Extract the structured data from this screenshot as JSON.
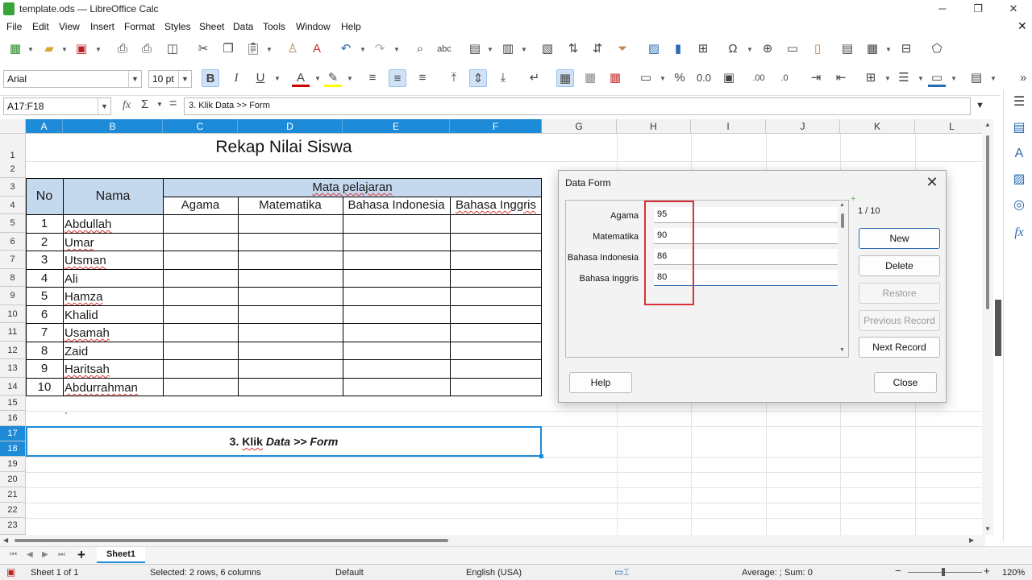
{
  "window": {
    "title": "template.ods — LibreOffice Calc"
  },
  "menubar": [
    "File",
    "Edit",
    "View",
    "Insert",
    "Format",
    "Styles",
    "Sheet",
    "Data",
    "Tools",
    "Window",
    "Help"
  ],
  "format_toolbar": {
    "font_name": "Arial",
    "font_size": "10 pt"
  },
  "formula_bar": {
    "name_box": "A17:F18",
    "fx": "fx",
    "sigma": "Σ",
    "equals": "=",
    "content": "3. Klik Data >> Form"
  },
  "columns": [
    "A",
    "B",
    "C",
    "D",
    "E",
    "F",
    "G",
    "H",
    "I",
    "J",
    "K",
    "L"
  ],
  "rows": [
    "1",
    "2",
    "3",
    "4",
    "5",
    "6",
    "7",
    "8",
    "9",
    "10",
    "11",
    "12",
    "13",
    "14",
    "15",
    "16",
    "17",
    "18",
    "19",
    "20",
    "21",
    "22",
    "23"
  ],
  "sheet": {
    "title": "Rekap Nilai Siswa",
    "header_no": "No",
    "header_nama": "Nama",
    "header_mapel": "Mata pelajaran",
    "subjects": [
      "Agama",
      "Matematika",
      "Bahasa Indonesia",
      "Bahasa Inggris"
    ],
    "students": [
      {
        "no": "1",
        "nama": "Abdullah"
      },
      {
        "no": "2",
        "nama": "Umar"
      },
      {
        "no": "3",
        "nama": "Utsman"
      },
      {
        "no": "4",
        "nama": "Ali"
      },
      {
        "no": "5",
        "nama": "Hamza"
      },
      {
        "no": "6",
        "nama": "Khalid"
      },
      {
        "no": "7",
        "nama": "Usamah"
      },
      {
        "no": "8",
        "nama": "Zaid"
      },
      {
        "no": "9",
        "nama": "Haritsah"
      },
      {
        "no": "10",
        "nama": "Abdurrahman"
      }
    ],
    "stray_mark": "`",
    "instruction_prefix": "3. ",
    "instruction_klik": "Klik",
    "instruction_data": "Data",
    "instruction_sep": ">>",
    "instruction_form": "Form"
  },
  "dialog": {
    "title": "Data Form",
    "close": "✕",
    "record_counter": "1 / 10",
    "fields": [
      {
        "label": "Agama",
        "value": "95"
      },
      {
        "label": "Matematika",
        "value": "90"
      },
      {
        "label": "Bahasa Indonesia",
        "value": "86"
      },
      {
        "label": "Bahasa Inggris",
        "value": "80"
      }
    ],
    "buttons": {
      "new": "New",
      "delete": "Delete",
      "restore": "Restore",
      "previous": "Previous Record",
      "next": "Next Record",
      "help": "Help",
      "close": "Close"
    },
    "highlight_color": "#d9303a"
  },
  "tabs": {
    "sheet1": "Sheet1",
    "add": "+"
  },
  "status": {
    "sheet": "Sheet 1 of 1",
    "selection": "Selected: 2 rows, 6 columns",
    "style": "Default",
    "language": "English (USA)",
    "summary": "Average: ; Sum: 0",
    "zoom": "120%"
  },
  "colors": {
    "accent": "#1e8bd8",
    "header_fill": "#c5d9ee"
  }
}
